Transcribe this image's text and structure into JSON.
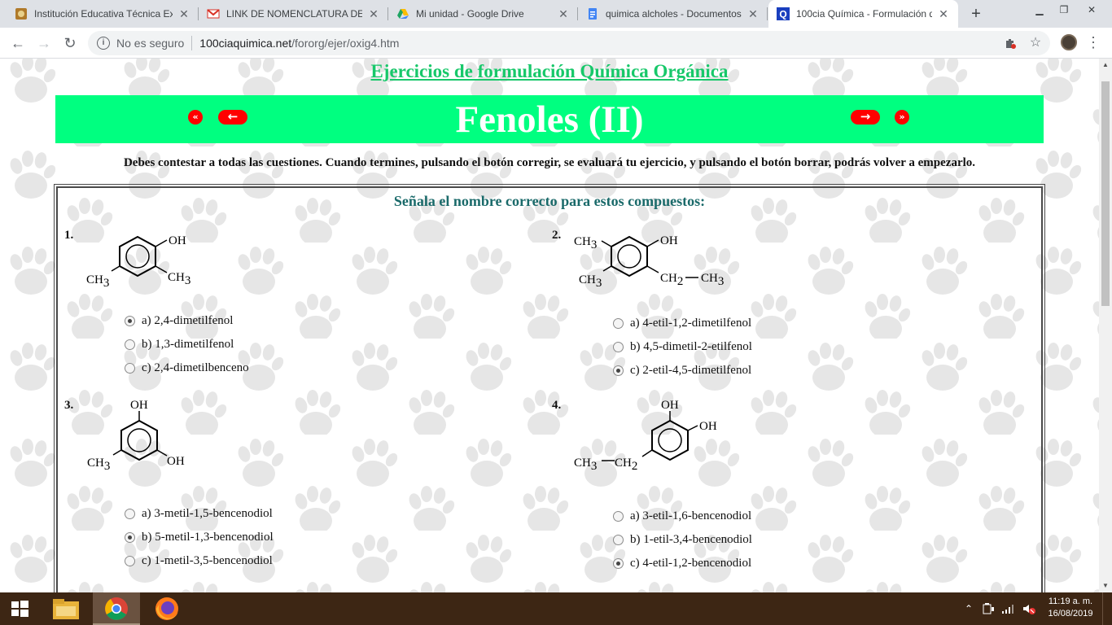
{
  "browser": {
    "tabs": [
      {
        "title": "Institución Educativa Técnica Ex",
        "favicon": "school-crest-icon",
        "active": false
      },
      {
        "title": "LINK DE NOMENCLATURA DE A",
        "favicon": "gmail-icon",
        "active": false
      },
      {
        "title": "Mi unidad - Google Drive",
        "favicon": "google-drive-icon",
        "active": false
      },
      {
        "title": "quimica alcholes - Documentos",
        "favicon": "google-docs-icon",
        "active": false
      },
      {
        "title": "100cia Química - Formulación d",
        "favicon": "100cia-q-icon",
        "active": true
      }
    ],
    "address": {
      "security_label": "No es seguro",
      "host": "100ciaquimica.net",
      "path": "/fororg/ejer/oxig4.htm"
    }
  },
  "page": {
    "site_title": "Ejercicios de formulación Química Orgánica",
    "banner_title": "Fenoles (II)",
    "nav": {
      "first": "«",
      "prev": "←",
      "next": "→",
      "last": "»"
    },
    "instructions": "Debes contestar a todas las cuestiones. Cuando termines, pulsando el botón corregir, se evaluará tu ejercicio, y pulsando el botón borrar, podrás volver a empezarlo.",
    "quiz_heading": "Señala el nombre correcto para estos compuestos:",
    "colors": {
      "banner": "#00ff80",
      "title": "#17c86a",
      "heading": "#1a6a6a",
      "nav_arrows": "#ff0000"
    }
  },
  "questions": [
    {
      "number": "1.",
      "labels": {
        "oh": "OH",
        "ch3_left": "CH",
        "ch3_left_sub": "3",
        "ch3_right": "CH",
        "ch3_right_sub": "3"
      },
      "options": [
        {
          "text": "a) 2,4-dimetilfenol",
          "selected": true
        },
        {
          "text": "b) 1,3-dimetilfenol",
          "selected": false
        },
        {
          "text": "c) 2,4-dimetilbenceno",
          "selected": false
        }
      ]
    },
    {
      "number": "2.",
      "labels": {
        "ch3_top": "CH",
        "ch3_top_sub": "3",
        "oh": "OH",
        "ch3_left": "CH",
        "ch3_left_sub": "3",
        "ch2": "CH",
        "ch2_sub": "2",
        "ch3_end": "CH",
        "ch3_end_sub": "3"
      },
      "options": [
        {
          "text": "a) 4-etil-1,2-dimetilfenol",
          "selected": false
        },
        {
          "text": "b) 4,5-dimetil-2-etilfenol",
          "selected": false
        },
        {
          "text": "c) 2-etil-4,5-dimetilfenol",
          "selected": true
        }
      ]
    },
    {
      "number": "3.",
      "labels": {
        "oh_top": "OH",
        "ch3_left": "CH",
        "ch3_left_sub": "3",
        "oh_right": "OH"
      },
      "options": [
        {
          "text": "a) 3-metil-1,5-bencenodiol",
          "selected": false
        },
        {
          "text": "b) 5-metil-1,3-bencenodiol",
          "selected": true
        },
        {
          "text": "c) 1-metil-3,5-bencenodiol",
          "selected": false
        }
      ]
    },
    {
      "number": "4.",
      "labels": {
        "oh_top": "OH",
        "oh_right": "OH",
        "ch3": "CH",
        "ch3_sub": "3",
        "ch2": "CH",
        "ch2_sub": "2"
      },
      "options": [
        {
          "text": "a) 3-etil-1,6-bencenodiol",
          "selected": false
        },
        {
          "text": "b) 1-etil-3,4-bencenodiol",
          "selected": false
        },
        {
          "text": "c) 4-etil-1,2-bencenodiol",
          "selected": true
        }
      ]
    }
  ],
  "taskbar": {
    "apps": [
      "windows-start-icon",
      "file-explorer-icon",
      "chrome-icon",
      "firefox-icon"
    ],
    "time": "11:19 a. m.",
    "date": "16/08/2019"
  }
}
